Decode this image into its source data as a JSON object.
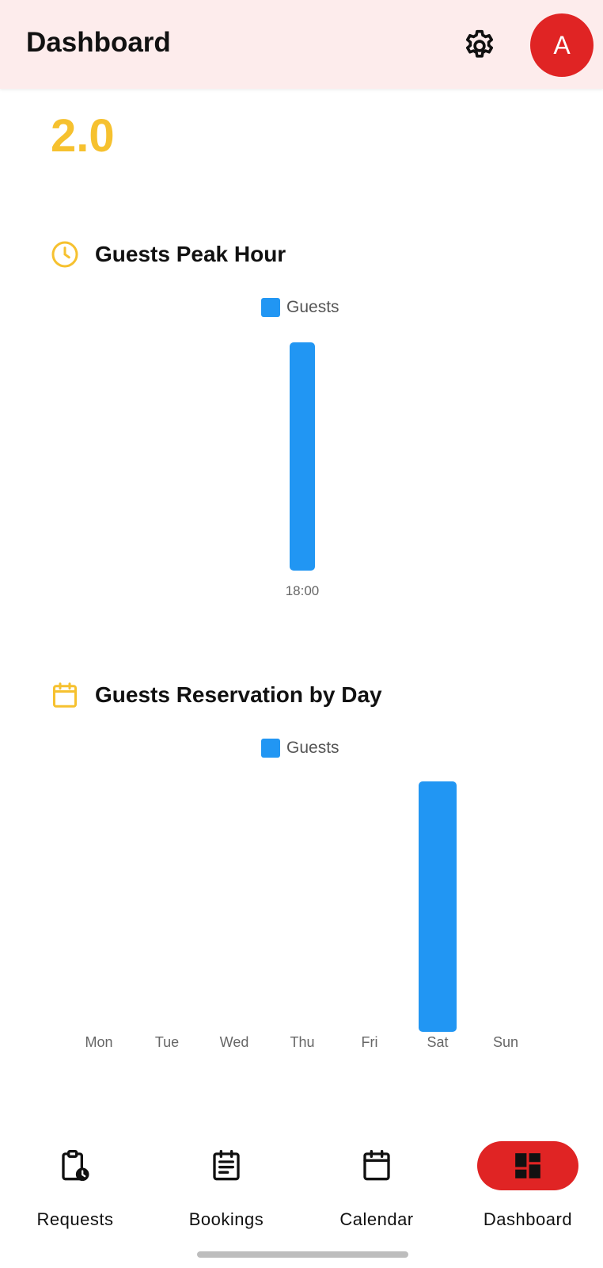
{
  "header": {
    "title": "Dashboard",
    "settings_icon": "gear-icon",
    "avatar_initial": "A"
  },
  "rating": {
    "value": "2.0",
    "color": "#f6c12f"
  },
  "peak_hour": {
    "title": "Guests Peak Hour",
    "icon": "clock-icon",
    "legend": "Guests"
  },
  "by_day": {
    "title": "Guests Reservation by Day",
    "icon": "calendar-icon",
    "legend": "Guests"
  },
  "chart_data": [
    {
      "type": "bar",
      "title": "Guests Peak Hour",
      "categories": [
        "18:00"
      ],
      "series": [
        {
          "name": "Guests",
          "values": [
            1
          ],
          "color": "#2196f3"
        }
      ],
      "legend": "top-center",
      "grid": false
    },
    {
      "type": "bar",
      "title": "Guests Reservation by Day",
      "categories": [
        "Mon",
        "Tue",
        "Wed",
        "Thu",
        "Fri",
        "Sat",
        "Sun"
      ],
      "series": [
        {
          "name": "Guests",
          "values": [
            0,
            0,
            0,
            0,
            0,
            1,
            0
          ],
          "color": "#2196f3"
        }
      ],
      "legend": "top-center",
      "grid": false
    }
  ],
  "nav": {
    "items": [
      {
        "label": "Requests",
        "icon": "clipboard-clock-icon",
        "active": false
      },
      {
        "label": "Bookings",
        "icon": "bookings-list-icon",
        "active": false
      },
      {
        "label": "Calendar",
        "icon": "calendar-icon",
        "active": false
      },
      {
        "label": "Dashboard",
        "icon": "dashboard-icon",
        "active": true
      }
    ],
    "active_color": "#e02424"
  }
}
